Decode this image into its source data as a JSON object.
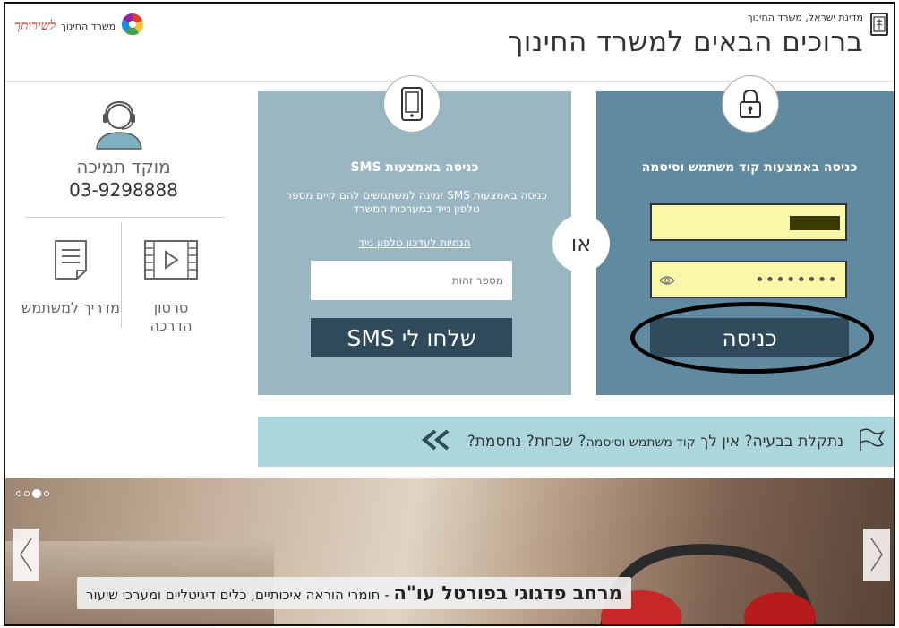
{
  "header": {
    "gov_title": "מדינת ישראל, משרד החינוך",
    "welcome": "ברוכים הבאים למשרד החינוך",
    "logo_tag": "לשירותך",
    "logo_ministry": "משרד החינוך"
  },
  "login_panel": {
    "title": "כניסה באמצעות קוד משתמש וסיסמה",
    "icon": "lock-icon",
    "password_mask": "••••••••",
    "submit_label": "כניסה"
  },
  "or_label": "או",
  "sms_panel": {
    "title": "כניסה באמצעות SMS",
    "icon": "mobile-phone-icon",
    "description": "כניסה באמצעות SMS זמינה למשתמשים להם קיים מספר טלפון נייד במערכות המשרד",
    "link": "הנחיות לעדכון טלפון נייד",
    "id_placeholder": "מספר זהות",
    "send_label": "שלחו לי SMS"
  },
  "support": {
    "icon": "headset-agent-icon",
    "title": "מוקד תמיכה",
    "phone": "03-9298888",
    "video_label": "סרטון הדרכה",
    "guide_label": "מדריך למשתמש"
  },
  "trouble": {
    "text_main": "נתקלת בבעיה? אין לך",
    "text_small": "קוד משתמש וסיסמה",
    "text_end": "? שכחת? נחסמת?"
  },
  "banner": {
    "caption_bold": "מרחב פדגוגי בפורטל עו\"ה",
    "caption_rest": " - חומרי הוראה איכותיים, כלים דיגיטליים ומערכי שיעור"
  },
  "colors": {
    "login_panel": "#5f8a9f",
    "sms_panel": "#9bb6c3",
    "button": "#2f4a5a",
    "field_highlight": "#fbf7a8",
    "trouble_bar": "#aad6dc"
  }
}
